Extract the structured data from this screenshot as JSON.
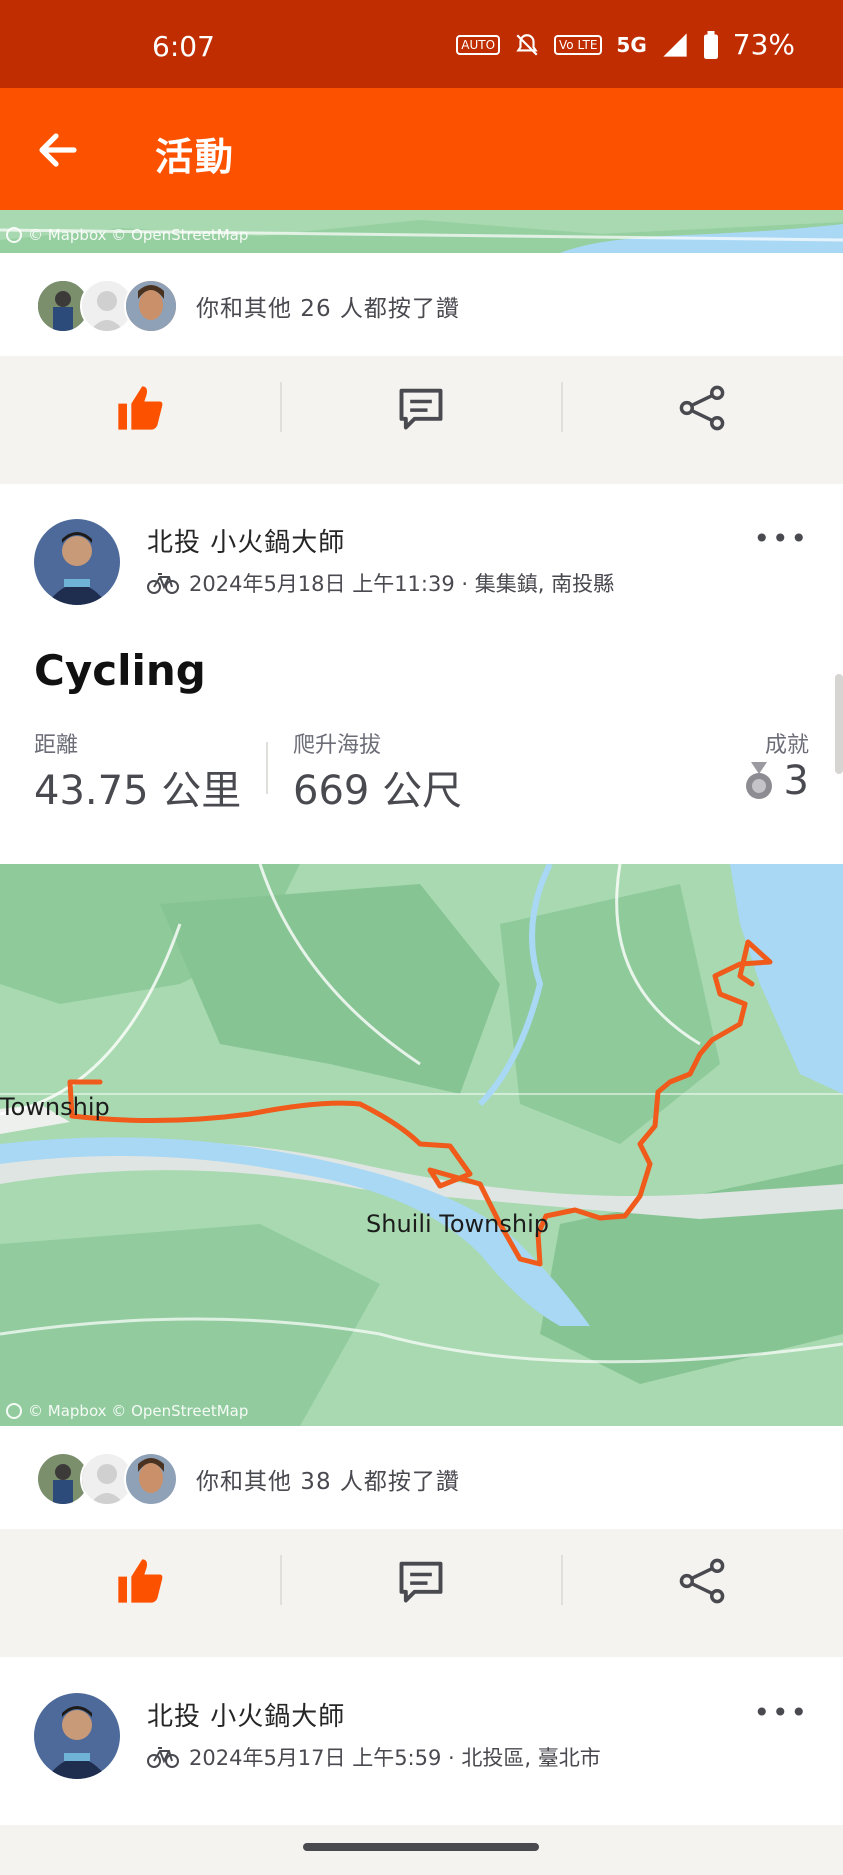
{
  "status": {
    "time": "6:07",
    "battery": "73%",
    "network": "5G",
    "icons": [
      "auto-hz-icon",
      "mute-icon",
      "volte-icon",
      "signal-icon",
      "battery-icon"
    ],
    "auto_label": "AUTO",
    "volte_label": "Vo LTE"
  },
  "appbar": {
    "title": "活動",
    "back_icon": "arrow-left-icon"
  },
  "attribution": "© Mapbox © OpenStreetMap",
  "post1": {
    "likes_text": "你和其他 26 人都按了讚"
  },
  "post2": {
    "athlete": "北投 小火鍋大師",
    "meta": "2024年5月18日 上午11:39 · 集集鎮, 南投縣",
    "title": "Cycling",
    "stats": [
      {
        "label": "距離",
        "value": "43.75 公里"
      },
      {
        "label": "爬升海拔",
        "value": "669 公尺"
      },
      {
        "label": "成就",
        "value": "3"
      }
    ],
    "map_labels": {
      "left_town": "Township",
      "center_town": "Shuili Township"
    },
    "likes_text": "你和其他 38 人都按了讚"
  },
  "post3": {
    "athlete": "北投 小火鍋大師",
    "meta": "2024年5月17日 上午5:59 · 北投區, 臺北市"
  },
  "more_label": "•••",
  "colors": {
    "brand": "#fc5200",
    "statusbar": "#bf2d00",
    "route": "#f05a1a",
    "map_green": "#a8d9b0",
    "water": "#a9d8f5"
  }
}
